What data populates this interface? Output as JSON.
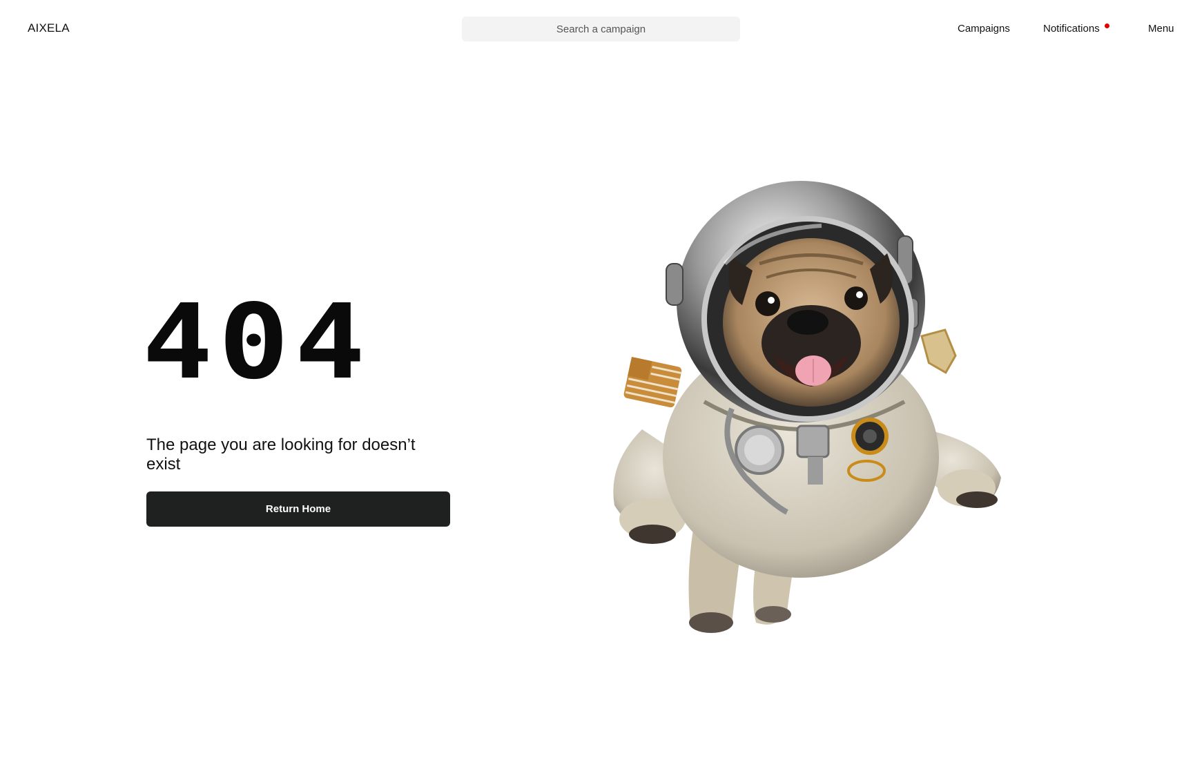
{
  "header": {
    "logo": "AIXELA",
    "search_placeholder": "Search a campaign",
    "nav": {
      "campaigns": "Campaigns",
      "notifications": "Notifications",
      "menu": "Menu"
    },
    "notification_dot_color": "#e10000"
  },
  "main": {
    "error_code": "404",
    "message": "The page you are looking for doesn’t exist",
    "return_button": "Return Home"
  },
  "illustration": {
    "icon": "astronaut-pug-illustration"
  },
  "colors": {
    "button_bg": "#1f2120",
    "search_bg": "#f3f3f3"
  }
}
